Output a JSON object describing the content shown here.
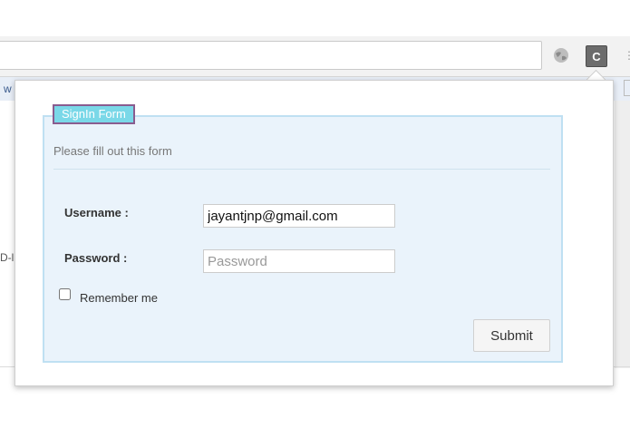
{
  "browser": {
    "bookmark_fragment": "w",
    "page_fragment": "D-l",
    "extension_badge": "C",
    "extension_icon": "globe-extension-icon"
  },
  "form": {
    "legend": "SignIn Form",
    "hint": "Please fill out this form",
    "username_label": "Username :",
    "username_value": "jayantjnp@gmail.com",
    "password_label": "Password :",
    "password_placeholder": "Password",
    "remember_label": "Remember me",
    "remember_checked": false,
    "submit_label": "Submit"
  },
  "colors": {
    "legend_bg": "#7ad8e8",
    "legend_border": "#8a5c8f",
    "fieldset_bg": "#eaf3fb",
    "fieldset_border": "#bfe0f2"
  }
}
